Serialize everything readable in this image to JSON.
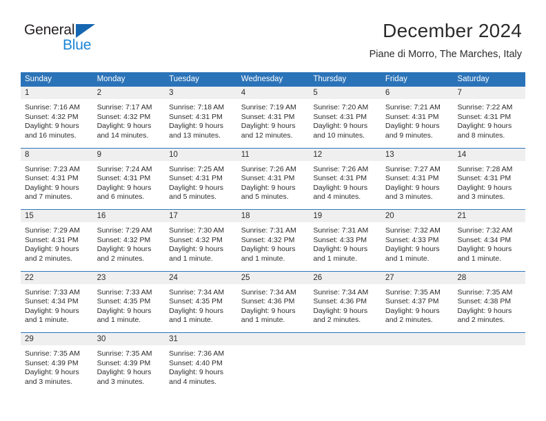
{
  "brand": {
    "name_part1": "General",
    "name_part2": "Blue",
    "logo_icon": "triangle-flag-icon"
  },
  "header": {
    "title": "December 2024",
    "subtitle": "Piane di Morro, The Marches, Italy"
  },
  "colors": {
    "header_blue": "#2b73b8",
    "daynum_band": "#efefef",
    "brand_blue": "#1a84d6",
    "logo_blue": "#1667b2",
    "text": "#2b2b2b"
  },
  "weekdays": [
    "Sunday",
    "Monday",
    "Tuesday",
    "Wednesday",
    "Thursday",
    "Friday",
    "Saturday"
  ],
  "weeks": [
    [
      {
        "day": "1",
        "lines": [
          "Sunrise: 7:16 AM",
          "Sunset: 4:32 PM",
          "Daylight: 9 hours",
          "and 16 minutes."
        ]
      },
      {
        "day": "2",
        "lines": [
          "Sunrise: 7:17 AM",
          "Sunset: 4:32 PM",
          "Daylight: 9 hours",
          "and 14 minutes."
        ]
      },
      {
        "day": "3",
        "lines": [
          "Sunrise: 7:18 AM",
          "Sunset: 4:31 PM",
          "Daylight: 9 hours",
          "and 13 minutes."
        ]
      },
      {
        "day": "4",
        "lines": [
          "Sunrise: 7:19 AM",
          "Sunset: 4:31 PM",
          "Daylight: 9 hours",
          "and 12 minutes."
        ]
      },
      {
        "day": "5",
        "lines": [
          "Sunrise: 7:20 AM",
          "Sunset: 4:31 PM",
          "Daylight: 9 hours",
          "and 10 minutes."
        ]
      },
      {
        "day": "6",
        "lines": [
          "Sunrise: 7:21 AM",
          "Sunset: 4:31 PM",
          "Daylight: 9 hours",
          "and 9 minutes."
        ]
      },
      {
        "day": "7",
        "lines": [
          "Sunrise: 7:22 AM",
          "Sunset: 4:31 PM",
          "Daylight: 9 hours",
          "and 8 minutes."
        ]
      }
    ],
    [
      {
        "day": "8",
        "lines": [
          "Sunrise: 7:23 AM",
          "Sunset: 4:31 PM",
          "Daylight: 9 hours",
          "and 7 minutes."
        ]
      },
      {
        "day": "9",
        "lines": [
          "Sunrise: 7:24 AM",
          "Sunset: 4:31 PM",
          "Daylight: 9 hours",
          "and 6 minutes."
        ]
      },
      {
        "day": "10",
        "lines": [
          "Sunrise: 7:25 AM",
          "Sunset: 4:31 PM",
          "Daylight: 9 hours",
          "and 5 minutes."
        ]
      },
      {
        "day": "11",
        "lines": [
          "Sunrise: 7:26 AM",
          "Sunset: 4:31 PM",
          "Daylight: 9 hours",
          "and 5 minutes."
        ]
      },
      {
        "day": "12",
        "lines": [
          "Sunrise: 7:26 AM",
          "Sunset: 4:31 PM",
          "Daylight: 9 hours",
          "and 4 minutes."
        ]
      },
      {
        "day": "13",
        "lines": [
          "Sunrise: 7:27 AM",
          "Sunset: 4:31 PM",
          "Daylight: 9 hours",
          "and 3 minutes."
        ]
      },
      {
        "day": "14",
        "lines": [
          "Sunrise: 7:28 AM",
          "Sunset: 4:31 PM",
          "Daylight: 9 hours",
          "and 3 minutes."
        ]
      }
    ],
    [
      {
        "day": "15",
        "lines": [
          "Sunrise: 7:29 AM",
          "Sunset: 4:31 PM",
          "Daylight: 9 hours",
          "and 2 minutes."
        ]
      },
      {
        "day": "16",
        "lines": [
          "Sunrise: 7:29 AM",
          "Sunset: 4:32 PM",
          "Daylight: 9 hours",
          "and 2 minutes."
        ]
      },
      {
        "day": "17",
        "lines": [
          "Sunrise: 7:30 AM",
          "Sunset: 4:32 PM",
          "Daylight: 9 hours",
          "and 1 minute."
        ]
      },
      {
        "day": "18",
        "lines": [
          "Sunrise: 7:31 AM",
          "Sunset: 4:32 PM",
          "Daylight: 9 hours",
          "and 1 minute."
        ]
      },
      {
        "day": "19",
        "lines": [
          "Sunrise: 7:31 AM",
          "Sunset: 4:33 PM",
          "Daylight: 9 hours",
          "and 1 minute."
        ]
      },
      {
        "day": "20",
        "lines": [
          "Sunrise: 7:32 AM",
          "Sunset: 4:33 PM",
          "Daylight: 9 hours",
          "and 1 minute."
        ]
      },
      {
        "day": "21",
        "lines": [
          "Sunrise: 7:32 AM",
          "Sunset: 4:34 PM",
          "Daylight: 9 hours",
          "and 1 minute."
        ]
      }
    ],
    [
      {
        "day": "22",
        "lines": [
          "Sunrise: 7:33 AM",
          "Sunset: 4:34 PM",
          "Daylight: 9 hours",
          "and 1 minute."
        ]
      },
      {
        "day": "23",
        "lines": [
          "Sunrise: 7:33 AM",
          "Sunset: 4:35 PM",
          "Daylight: 9 hours",
          "and 1 minute."
        ]
      },
      {
        "day": "24",
        "lines": [
          "Sunrise: 7:34 AM",
          "Sunset: 4:35 PM",
          "Daylight: 9 hours",
          "and 1 minute."
        ]
      },
      {
        "day": "25",
        "lines": [
          "Sunrise: 7:34 AM",
          "Sunset: 4:36 PM",
          "Daylight: 9 hours",
          "and 1 minute."
        ]
      },
      {
        "day": "26",
        "lines": [
          "Sunrise: 7:34 AM",
          "Sunset: 4:36 PM",
          "Daylight: 9 hours",
          "and 2 minutes."
        ]
      },
      {
        "day": "27",
        "lines": [
          "Sunrise: 7:35 AM",
          "Sunset: 4:37 PM",
          "Daylight: 9 hours",
          "and 2 minutes."
        ]
      },
      {
        "day": "28",
        "lines": [
          "Sunrise: 7:35 AM",
          "Sunset: 4:38 PM",
          "Daylight: 9 hours",
          "and 2 minutes."
        ]
      }
    ],
    [
      {
        "day": "29",
        "lines": [
          "Sunrise: 7:35 AM",
          "Sunset: 4:39 PM",
          "Daylight: 9 hours",
          "and 3 minutes."
        ]
      },
      {
        "day": "30",
        "lines": [
          "Sunrise: 7:35 AM",
          "Sunset: 4:39 PM",
          "Daylight: 9 hours",
          "and 3 minutes."
        ]
      },
      {
        "day": "31",
        "lines": [
          "Sunrise: 7:36 AM",
          "Sunset: 4:40 PM",
          "Daylight: 9 hours",
          "and 4 minutes."
        ]
      },
      {
        "day": "",
        "lines": []
      },
      {
        "day": "",
        "lines": []
      },
      {
        "day": "",
        "lines": []
      },
      {
        "day": "",
        "lines": []
      }
    ]
  ]
}
